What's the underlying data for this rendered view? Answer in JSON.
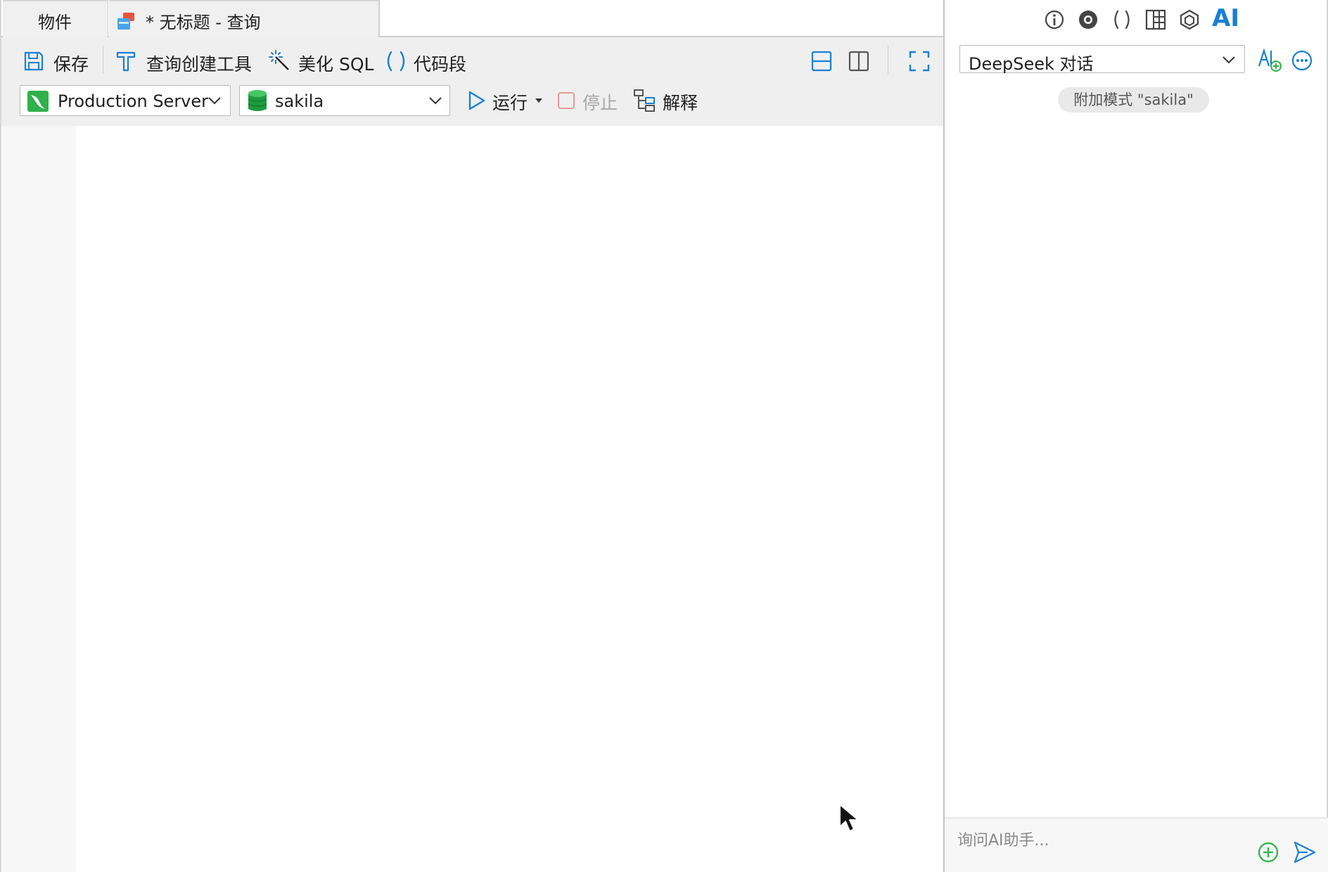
{
  "tabs": {
    "objects_label": "物件",
    "query_label": "* 无标题 - 查询"
  },
  "toolbar": {
    "save_label": "保存",
    "query_builder_label": "查询创建工具",
    "beautify_label": "美化 SQL",
    "snippet_label": "代码段",
    "run_label": "运行",
    "stop_label": "停止",
    "explain_label": "解释"
  },
  "connection": {
    "server_label": "Production Server",
    "database_label": "sakila"
  },
  "ai_panel": {
    "tab_ai_label": "AI",
    "model_selected": "DeepSeek 对话",
    "attach_chip": "附加模式 \"sakila\"",
    "input_placeholder": "询问AI助手..."
  },
  "colors": {
    "accent_blue": "#1a7fd4",
    "green": "#2fb24a",
    "stop_red": "#e89a9a",
    "toolbar_bg": "#efefef"
  }
}
